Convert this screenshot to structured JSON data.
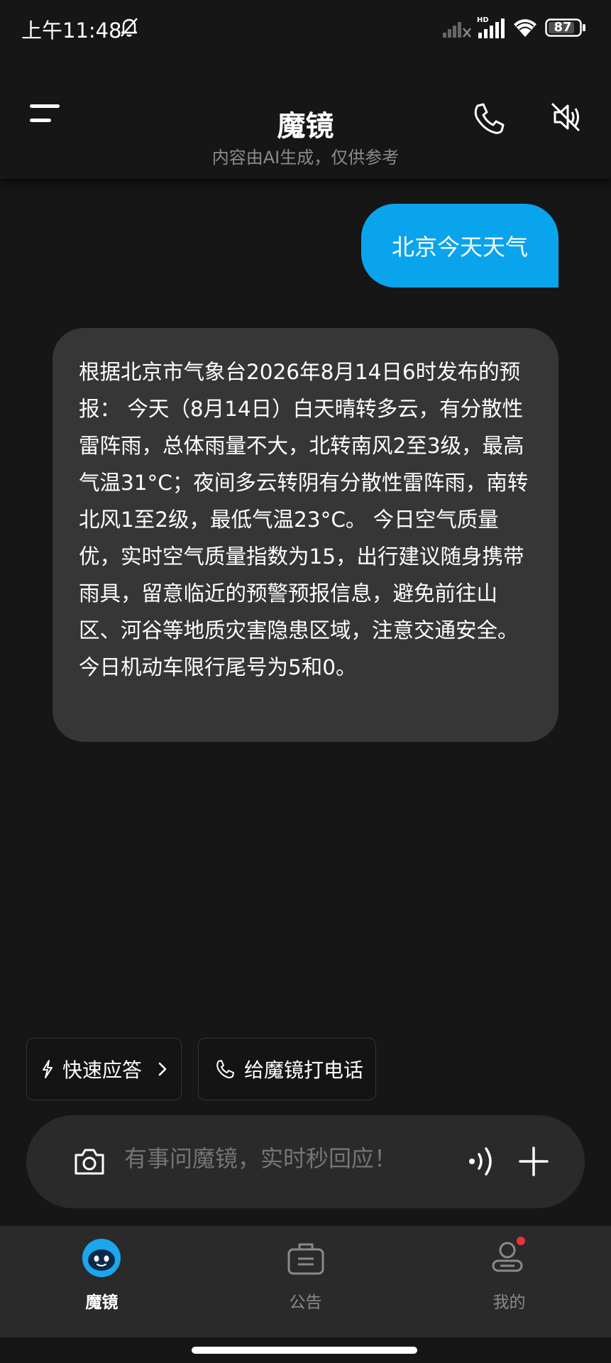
{
  "statusbar": {
    "time": "上午11:48",
    "battery": "87"
  },
  "header": {
    "title": "魔镜",
    "subtitle": "内容由AI生成，仅供参考"
  },
  "chat": {
    "user_message": "北京今天天气",
    "bot_message": "根据北京市气象台2026年8月14日6时发布的预报： 今天（8月14日）白天晴转多云，有分散性雷阵雨，总体雨量不大，北转南风2至3级，最高气温31°C；夜间多云转阴有分散性雷阵雨，南转北风1至2级，最低气温23°C。 今日空气质量优，实时空气质量指数为15，出行建议随身携带雨具，留意临近的预警预报信息，避免前往山区、河谷等地质灾害隐患区域，注意交通安全。今日机动车限行尾号为5和0。"
  },
  "quick_actions": {
    "quick_reply": "快速应答",
    "call_mirror": "给魔镜打电话"
  },
  "input": {
    "placeholder": "有事问魔镜，实时秒回应！"
  },
  "nav": {
    "items": [
      {
        "label": "魔镜",
        "active": true
      },
      {
        "label": "公告",
        "active": false
      },
      {
        "label": "我的",
        "active": false,
        "badge": true
      }
    ]
  },
  "colors": {
    "background": "#161616",
    "user_bubble": "#0aa4ec",
    "bot_bubble": "#363636",
    "bar": "#2a2a2a",
    "badge": "#e8323c",
    "avatar": "#1aa7ec"
  },
  "icons": [
    "bell-mute-icon",
    "signal-icon",
    "hd-signal-icon",
    "wifi-icon",
    "battery-icon",
    "menu-icon",
    "phone-icon",
    "speaker-mute-icon",
    "lightning-icon",
    "chevron-right-icon",
    "phone-small-icon",
    "camera-icon",
    "voice-wave-icon",
    "plus-icon",
    "robot-avatar-icon",
    "briefcase-icon",
    "user-icon"
  ]
}
